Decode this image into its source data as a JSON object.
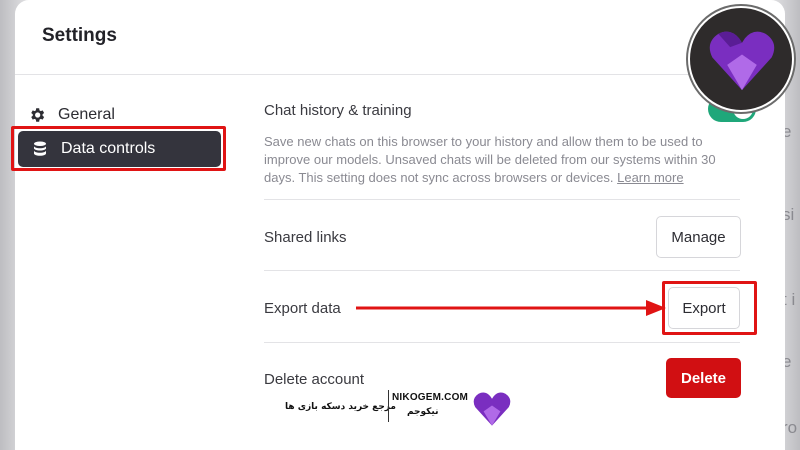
{
  "settings": {
    "title": "Settings",
    "nav": [
      {
        "label": "General",
        "icon": "gear-icon"
      },
      {
        "label": "Data controls",
        "icon": "database-icon",
        "selected": true
      }
    ]
  },
  "data_controls": {
    "chat_history": {
      "title": "Chat history & training",
      "description": "Save new chats on this browser to your history and allow them to be used to improve our models. Unsaved chats will be deleted from our systems within 30 days. This setting does not sync across browsers or devices.",
      "learn_more": "Learn more",
      "enabled": true
    },
    "shared_links": {
      "title": "Shared links",
      "button": "Manage"
    },
    "export_data": {
      "title": "Export data",
      "button": "Export"
    },
    "delete_account": {
      "title": "Delete account",
      "button": "Delete"
    }
  },
  "watermark": {
    "site": "NIKOGEM.COM",
    "tagline_fa": "مرجع خرید دسکه بازی ها",
    "brand_fa": "نیکوجم"
  },
  "colors": {
    "toggle_on": "#1fa77a",
    "delete_red": "#d10f12",
    "annotation_red": "#e01414",
    "selected_nav": "#34343d",
    "brand_purple": "#7a2ec0"
  }
}
